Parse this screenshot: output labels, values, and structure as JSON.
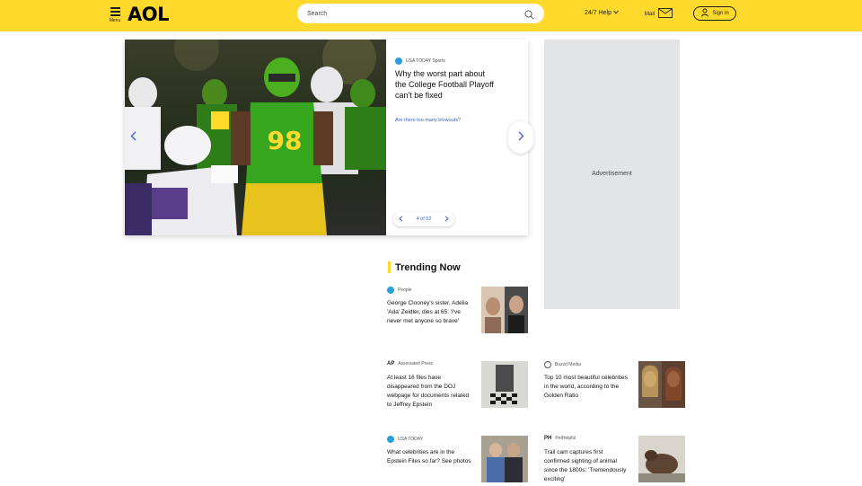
{
  "header": {
    "menu_label": "Menu",
    "logo": "AOL",
    "search_placeholder": "Search",
    "help_label": "24/7 Help",
    "mail_label": "Mail",
    "signin_label": "Sign in"
  },
  "hero": {
    "source": "USA TODAY Sports",
    "title": "Why the worst part about the College Football Playoff can't be fixed",
    "link": "Are there too many blowouts?",
    "pager": "4 of 52",
    "jersey": "98"
  },
  "ad": {
    "label": "Advertisement"
  },
  "trending": {
    "heading": "Trending Now",
    "cards": [
      {
        "source": "People",
        "title": "George Clooney's sister, Adelia 'Ada' Zeidler, dies at 65: 'I've never met anyone so brave'",
        "color": "#2b9fd8"
      },
      {
        "source": "Associated Press",
        "title": "At least 16 files have disappeared from the DOJ webpage for documents related to Jeffrey Epstein",
        "color": "#111111"
      },
      {
        "source": "Buzzd Media",
        "title": "Top 10 most beautiful celebrities in the world, according to the Golden Ratio",
        "color": "#555555"
      },
      {
        "source": "USA TODAY",
        "title": "What celebrities are in the Epstein Files so far? See photos",
        "color": "#2b9fd8"
      },
      {
        "source": "PetHelpful",
        "title": "Trail cam captures first confirmed sighting of animal since the 1800s: 'Tremendously exciting'",
        "color": "#111111"
      }
    ]
  },
  "colors": {
    "brand": "#ffd92b",
    "accent": "#3f63c7"
  }
}
